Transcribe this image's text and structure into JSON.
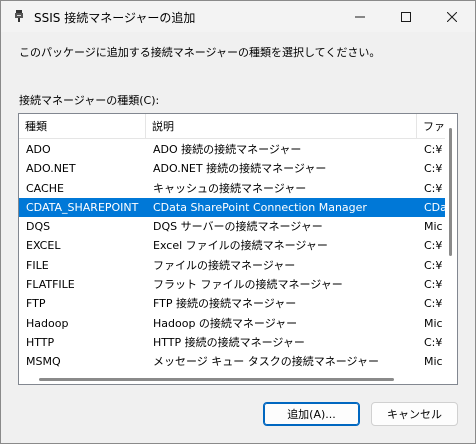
{
  "window": {
    "title": "SSIS 接続マネージャーの追加",
    "minimize_icon": "minimize-icon",
    "maximize_icon": "maximize-icon",
    "close_icon": "close-icon"
  },
  "instruction": "このパッケージに追加する接続マネージャーの種類を選択してください。",
  "list_label": "接続マネージャーの種類(C):",
  "columns": [
    "種類",
    "説明",
    "ファ"
  ],
  "rows": [
    {
      "type": "ADO",
      "desc": "ADO 接続の接続マネージャー",
      "file": "C:¥"
    },
    {
      "type": "ADO.NET",
      "desc": "ADO.NET 接続の接続マネージャー",
      "file": "C:¥"
    },
    {
      "type": "CACHE",
      "desc": "キャッシュの接続マネージャー",
      "file": "C:¥"
    },
    {
      "type": "CDATA_SHAREPOINT",
      "desc": "CData SharePoint Connection Manager",
      "file": "CDa"
    },
    {
      "type": "DQS",
      "desc": "DQS サーバーの接続マネージャー",
      "file": "Mic"
    },
    {
      "type": "EXCEL",
      "desc": "Excel ファイルの接続マネージャー",
      "file": "C:¥"
    },
    {
      "type": "FILE",
      "desc": "ファイルの接続マネージャー",
      "file": "C:¥"
    },
    {
      "type": "FLATFILE",
      "desc": "フラット ファイルの接続マネージャー",
      "file": "C:¥"
    },
    {
      "type": "FTP",
      "desc": "FTP 接続の接続マネージャー",
      "file": "C:¥"
    },
    {
      "type": "Hadoop",
      "desc": "Hadoop の接続マネージャー",
      "file": "Mic"
    },
    {
      "type": "HTTP",
      "desc": "HTTP 接続の接続マネージャー",
      "file": "C:¥"
    },
    {
      "type": "MSMQ",
      "desc": "メッセージ キュー タスクの接続マネージャー",
      "file": "Mic"
    }
  ],
  "selected_index": 3,
  "buttons": {
    "add": "追加(A)...",
    "cancel": "キャンセル"
  },
  "colors": {
    "selection": "#0078d7",
    "default_button_border": "#0067c0"
  }
}
